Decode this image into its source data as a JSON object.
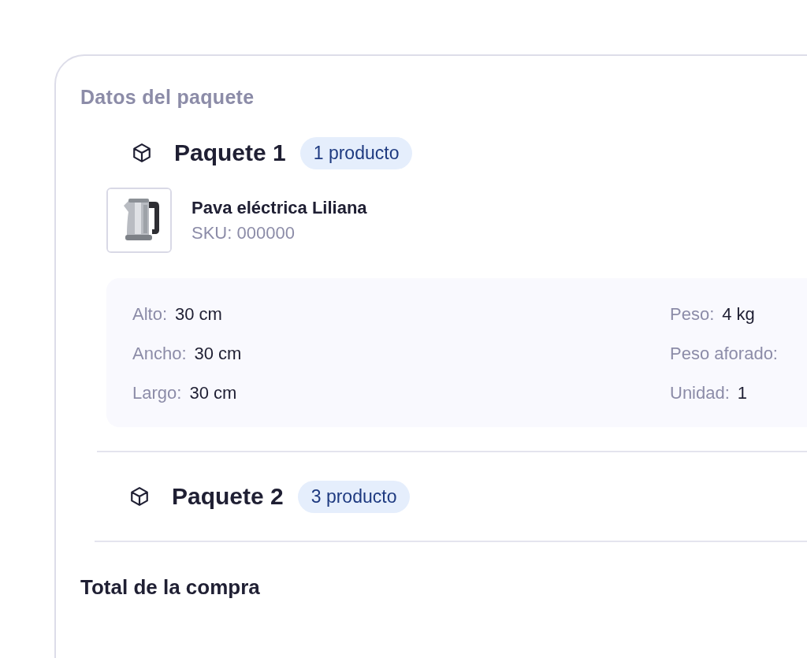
{
  "section_title": "Datos del paquete",
  "packages": [
    {
      "title": "Paquete 1",
      "badge": "1 producto",
      "products": [
        {
          "name": "Pava eléctrica Liliana",
          "sku": "SKU: 000000"
        }
      ],
      "dimensions": {
        "left": [
          {
            "label": "Alto:",
            "value": "30 cm"
          },
          {
            "label": "Ancho:",
            "value": "30 cm"
          },
          {
            "label": "Largo:",
            "value": "30 cm"
          }
        ],
        "right": [
          {
            "label": "Peso:",
            "value": "4 kg"
          },
          {
            "label": "Peso aforado:"
          },
          {
            "label": "Unidad:",
            "value": "1"
          }
        ]
      }
    },
    {
      "title": "Paquete 2",
      "badge": "3 producto"
    }
  ],
  "total_title": "Total de la compra"
}
